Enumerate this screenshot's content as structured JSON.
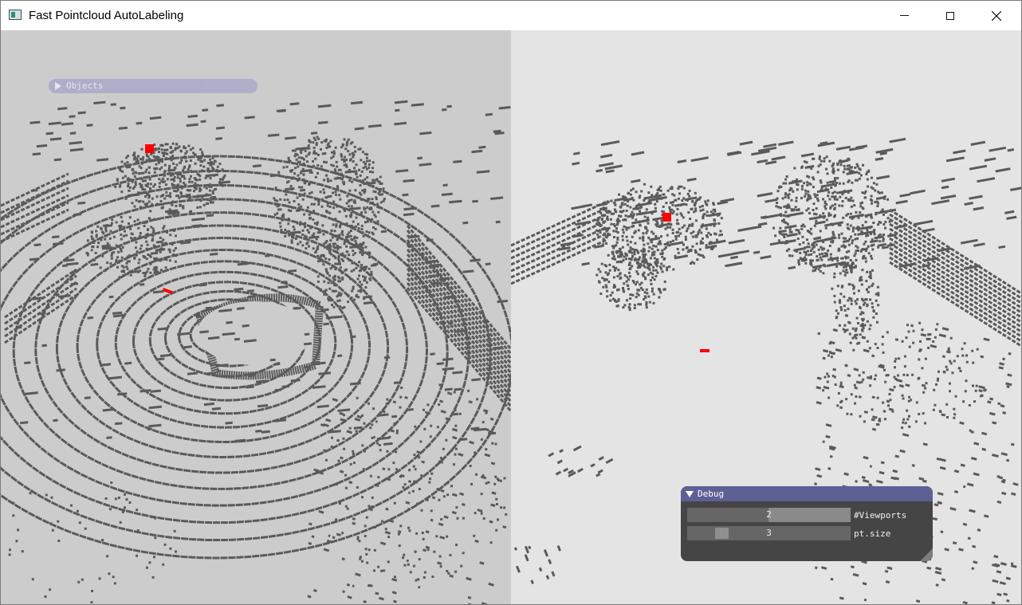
{
  "window": {
    "title": "Fast Pointcloud AutoLabeling",
    "controls": {
      "minimize": "minimize",
      "maximize": "maximize",
      "close": "close"
    }
  },
  "viewports": {
    "count": 2,
    "left_background": "#cccccc",
    "right_background": "#e4e4e4",
    "point_color": "#5a5a5a",
    "object_marker_color": "#ff0000"
  },
  "objects_panel": {
    "title": "Objects",
    "collapsed": true
  },
  "debug_panel": {
    "title": "Debug",
    "collapsed": false,
    "controls": [
      {
        "label": "#Viewports",
        "value": "2",
        "fraction": 0.5
      },
      {
        "label": "pt.size",
        "value": "3",
        "fraction": 0.2
      }
    ]
  }
}
